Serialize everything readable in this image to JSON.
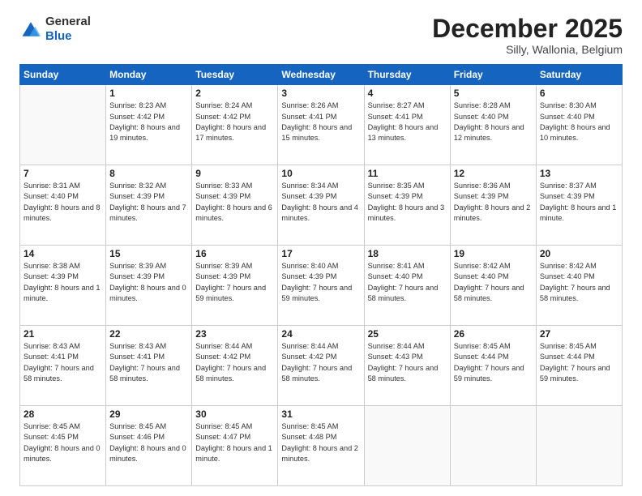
{
  "header": {
    "logo": {
      "line1": "General",
      "line2": "Blue"
    },
    "title": "December 2025",
    "location": "Silly, Wallonia, Belgium"
  },
  "days_of_week": [
    "Sunday",
    "Monday",
    "Tuesday",
    "Wednesday",
    "Thursday",
    "Friday",
    "Saturday"
  ],
  "weeks": [
    [
      {
        "day": "",
        "info": ""
      },
      {
        "day": "1",
        "info": "Sunrise: 8:23 AM\nSunset: 4:42 PM\nDaylight: 8 hours\nand 19 minutes."
      },
      {
        "day": "2",
        "info": "Sunrise: 8:24 AM\nSunset: 4:42 PM\nDaylight: 8 hours\nand 17 minutes."
      },
      {
        "day": "3",
        "info": "Sunrise: 8:26 AM\nSunset: 4:41 PM\nDaylight: 8 hours\nand 15 minutes."
      },
      {
        "day": "4",
        "info": "Sunrise: 8:27 AM\nSunset: 4:41 PM\nDaylight: 8 hours\nand 13 minutes."
      },
      {
        "day": "5",
        "info": "Sunrise: 8:28 AM\nSunset: 4:40 PM\nDaylight: 8 hours\nand 12 minutes."
      },
      {
        "day": "6",
        "info": "Sunrise: 8:30 AM\nSunset: 4:40 PM\nDaylight: 8 hours\nand 10 minutes."
      }
    ],
    [
      {
        "day": "7",
        "info": "Sunrise: 8:31 AM\nSunset: 4:40 PM\nDaylight: 8 hours\nand 8 minutes."
      },
      {
        "day": "8",
        "info": "Sunrise: 8:32 AM\nSunset: 4:39 PM\nDaylight: 8 hours\nand 7 minutes."
      },
      {
        "day": "9",
        "info": "Sunrise: 8:33 AM\nSunset: 4:39 PM\nDaylight: 8 hours\nand 6 minutes."
      },
      {
        "day": "10",
        "info": "Sunrise: 8:34 AM\nSunset: 4:39 PM\nDaylight: 8 hours\nand 4 minutes."
      },
      {
        "day": "11",
        "info": "Sunrise: 8:35 AM\nSunset: 4:39 PM\nDaylight: 8 hours\nand 3 minutes."
      },
      {
        "day": "12",
        "info": "Sunrise: 8:36 AM\nSunset: 4:39 PM\nDaylight: 8 hours\nand 2 minutes."
      },
      {
        "day": "13",
        "info": "Sunrise: 8:37 AM\nSunset: 4:39 PM\nDaylight: 8 hours\nand 1 minute."
      }
    ],
    [
      {
        "day": "14",
        "info": "Sunrise: 8:38 AM\nSunset: 4:39 PM\nDaylight: 8 hours\nand 1 minute."
      },
      {
        "day": "15",
        "info": "Sunrise: 8:39 AM\nSunset: 4:39 PM\nDaylight: 8 hours\nand 0 minutes."
      },
      {
        "day": "16",
        "info": "Sunrise: 8:39 AM\nSunset: 4:39 PM\nDaylight: 7 hours\nand 59 minutes."
      },
      {
        "day": "17",
        "info": "Sunrise: 8:40 AM\nSunset: 4:39 PM\nDaylight: 7 hours\nand 59 minutes."
      },
      {
        "day": "18",
        "info": "Sunrise: 8:41 AM\nSunset: 4:40 PM\nDaylight: 7 hours\nand 58 minutes."
      },
      {
        "day": "19",
        "info": "Sunrise: 8:42 AM\nSunset: 4:40 PM\nDaylight: 7 hours\nand 58 minutes."
      },
      {
        "day": "20",
        "info": "Sunrise: 8:42 AM\nSunset: 4:40 PM\nDaylight: 7 hours\nand 58 minutes."
      }
    ],
    [
      {
        "day": "21",
        "info": "Sunrise: 8:43 AM\nSunset: 4:41 PM\nDaylight: 7 hours\nand 58 minutes."
      },
      {
        "day": "22",
        "info": "Sunrise: 8:43 AM\nSunset: 4:41 PM\nDaylight: 7 hours\nand 58 minutes."
      },
      {
        "day": "23",
        "info": "Sunrise: 8:44 AM\nSunset: 4:42 PM\nDaylight: 7 hours\nand 58 minutes."
      },
      {
        "day": "24",
        "info": "Sunrise: 8:44 AM\nSunset: 4:42 PM\nDaylight: 7 hours\nand 58 minutes."
      },
      {
        "day": "25",
        "info": "Sunrise: 8:44 AM\nSunset: 4:43 PM\nDaylight: 7 hours\nand 58 minutes."
      },
      {
        "day": "26",
        "info": "Sunrise: 8:45 AM\nSunset: 4:44 PM\nDaylight: 7 hours\nand 59 minutes."
      },
      {
        "day": "27",
        "info": "Sunrise: 8:45 AM\nSunset: 4:44 PM\nDaylight: 7 hours\nand 59 minutes."
      }
    ],
    [
      {
        "day": "28",
        "info": "Sunrise: 8:45 AM\nSunset: 4:45 PM\nDaylight: 8 hours\nand 0 minutes."
      },
      {
        "day": "29",
        "info": "Sunrise: 8:45 AM\nSunset: 4:46 PM\nDaylight: 8 hours\nand 0 minutes."
      },
      {
        "day": "30",
        "info": "Sunrise: 8:45 AM\nSunset: 4:47 PM\nDaylight: 8 hours\nand 1 minute."
      },
      {
        "day": "31",
        "info": "Sunrise: 8:45 AM\nSunset: 4:48 PM\nDaylight: 8 hours\nand 2 minutes."
      },
      {
        "day": "",
        "info": ""
      },
      {
        "day": "",
        "info": ""
      },
      {
        "day": "",
        "info": ""
      }
    ]
  ]
}
